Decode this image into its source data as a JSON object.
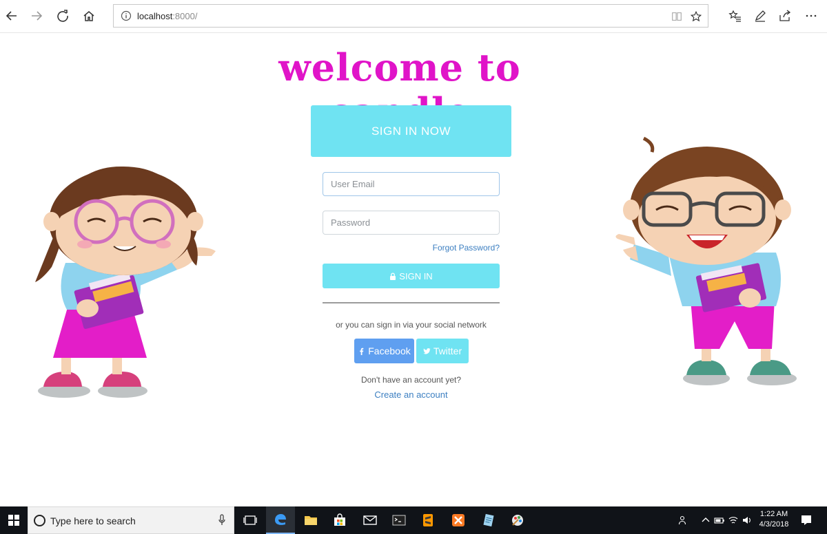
{
  "browser": {
    "url_host": "localhost",
    "url_port": ":8000/"
  },
  "page": {
    "title": "welcome to candle",
    "banner": "SIGN IN NOW",
    "email_placeholder": "User Email",
    "password_placeholder": "Password",
    "forgot_password": "Forgot Password?",
    "signin_label": "SIGN IN",
    "social_text": "or you can sign in via your social network",
    "facebook_label": "Facebook",
    "twitter_label": "Twitter",
    "no_account": "Don't have an account yet?",
    "create_account": "Create an account"
  },
  "taskbar": {
    "search_placeholder": "Type here to search",
    "time": "1:22 AM",
    "date": "4/3/2018"
  },
  "colors": {
    "title": "#e014c8",
    "accent": "#6fe3f2",
    "facebook": "#5f9ff0",
    "link": "#3c7fc1"
  }
}
